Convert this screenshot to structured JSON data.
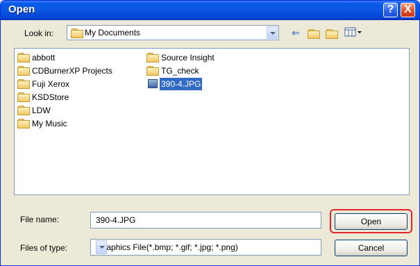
{
  "window": {
    "title": "Open",
    "help_label": "?",
    "close_label": "X"
  },
  "lookin": {
    "label": "Look in:",
    "value": "My Documents",
    "icon": "documents-folder-icon"
  },
  "toolbar": [
    "back-icon",
    "up-folder-icon",
    "new-folder-icon",
    "view-menu-icon"
  ],
  "files": [
    {
      "name": "abbott",
      "type": "folder"
    },
    {
      "name": "CDBurnerXP Projects",
      "type": "folder"
    },
    {
      "name": "Fuji Xerox",
      "type": "folder"
    },
    {
      "name": "KSDStore",
      "type": "folder"
    },
    {
      "name": "LDW",
      "type": "folder"
    },
    {
      "name": "My Music",
      "type": "folder"
    },
    {
      "name": "Source Insight",
      "type": "folder"
    },
    {
      "name": "TG_check",
      "type": "folder"
    },
    {
      "name": "390-4.JPG",
      "type": "image",
      "selected": true
    }
  ],
  "filename": {
    "label": "File name:",
    "value": "390-4.JPG"
  },
  "filetype": {
    "label": "Files of type:",
    "value": "Graphics File(*.bmp; *.gif; *.jpg; *.png)"
  },
  "buttons": {
    "open": "Open",
    "cancel": "Cancel"
  },
  "colors": {
    "title_bar": "#0a58e3",
    "selection": "#316ac5",
    "highlight_box": "#e0262a"
  }
}
